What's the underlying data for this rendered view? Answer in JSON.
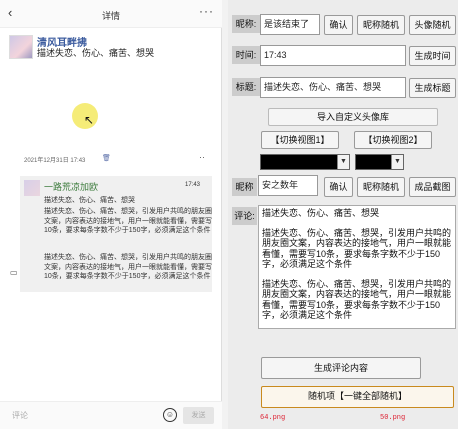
{
  "phone": {
    "header": {
      "back_icon": "‹",
      "title": "详情",
      "more_icon": "···"
    },
    "post": {
      "name": "清风耳畔拂",
      "text": "描述失恋、伤心、痛苦、想哭",
      "time": "2021年12月31日 17:43",
      "delete_icon": "trash-icon",
      "more_icon": "··"
    },
    "comment": {
      "name": "一路荒凉加欧",
      "time": "17:43",
      "title": "描述失恋、伤心、痛苦、想哭",
      "para1": "描述失恋、伤心、痛苦、想哭，引发用户共鸣的朋友圈文案，内容表达的接地气，用户一眼就能看懂，需要写10条，要求每条字数不少于150字，必须满足这个条件",
      "para2": "描述失恋、伤心、痛苦、想哭，引发用户共鸣的朋友圈文案，内容表达的接地气，用户一眼就能看懂，需要写10条，要求每条字数不少于150字，必须满足这个条件"
    },
    "footer": {
      "input_placeholder": "评论",
      "send_label": "发送"
    }
  },
  "controls": {
    "nickname_label": "昵称:",
    "nickname_value": "是该结束了",
    "confirm_label": "确认",
    "random_nick_label": "昵称随机",
    "random_avatar_label": "头像随机",
    "time_label": "时间:",
    "time_value": "17:43",
    "gen_time_label": "生成时间",
    "title_label": "标题:",
    "title_value": "描述失恋、伤心、痛苦、想哭",
    "gen_title_label": "生成标题",
    "import_avatar_label": "导入自定义头像库",
    "view1_label": "【切换视图1】",
    "view2_label": "【切换视图2】",
    "nickname2_label": "昵称",
    "nickname2_value": "安之数年",
    "confirm2_label": "确认",
    "random_nick2_label": "昵称随机",
    "finished_img_label": "成品截图",
    "comment_label": "评论:",
    "comment_title": "描述失恋、伤心、痛苦、想哭",
    "comment_para1": "描述失恋、伤心、痛苦、想哭，引发用户共鸣的朋友圈文案，内容表达的接地气，用户一眼就能看懂，需要写10条，要求每条字数不少于150字，必须满足这个条件",
    "comment_para2": "描述失恋、伤心、痛苦、想哭，引发用户共鸣的朋友圈文案，内容表达的接地气，用户一眼就能看懂，需要写10条，要求每条字数不少于150字，必须满足这个条件",
    "gen_comment_label": "生成评论内容",
    "random_all_label": "随机项【一键全部随机】",
    "img_left": "64.png",
    "img_right": "50.png"
  },
  "colors": {
    "link_blue": "#3b5b9e",
    "comment_green": "#3d7c3d",
    "accent_orange": "#c98a1e",
    "file_red": "#d23"
  }
}
